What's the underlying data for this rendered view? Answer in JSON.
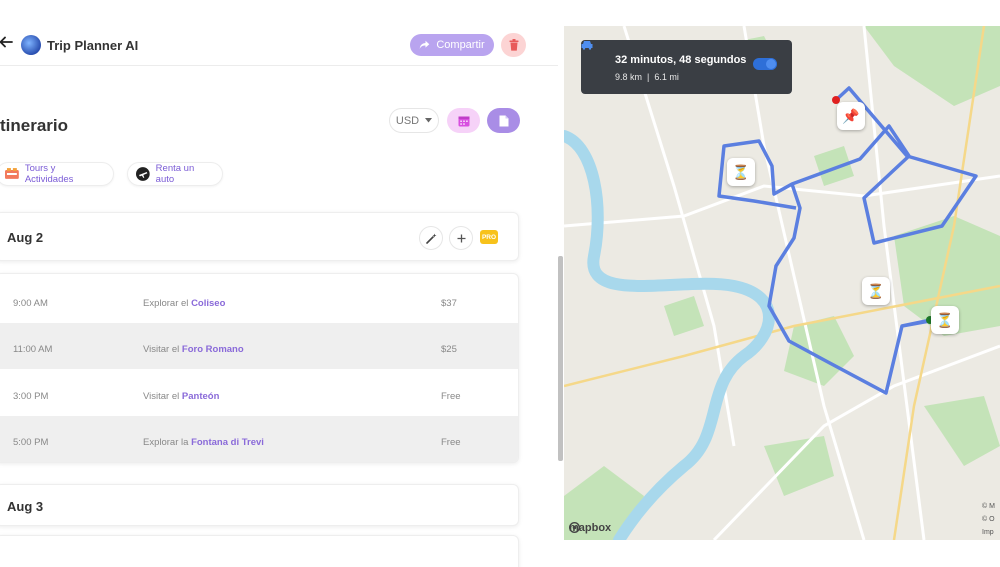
{
  "header": {
    "app_title": "Trip Planner AI",
    "share_label": "Compartir"
  },
  "itinerary": {
    "title": "tinerario",
    "currency": "USD"
  },
  "quick_links": {
    "tours_label": "Tours y Actividades",
    "car_label": "Renta un auto"
  },
  "days": [
    {
      "label": "Aug 2",
      "pro_badge": "PRO",
      "activities": [
        {
          "time": "9:00 AM",
          "verb": "Explorar el",
          "place": "Coliseo",
          "price": "$37"
        },
        {
          "time": "11:00 AM",
          "verb": "Visitar el",
          "place": "Foro Romano",
          "price": "$25"
        },
        {
          "time": "3:00 PM",
          "verb": "Visitar el",
          "place": "Panteón",
          "price": "Free"
        },
        {
          "time": "5:00 PM",
          "verb": "Explorar la",
          "place": "Fontana di Trevi",
          "price": "Free"
        }
      ]
    },
    {
      "label": "Aug 3"
    }
  ],
  "map": {
    "route_duration": "32 minutos, 48 segundos",
    "route_km": "9.8 km",
    "route_separator": "|",
    "route_mi": "6.1 mi",
    "route_toggle_on": true,
    "mapbox_label": "mapbox",
    "attribution_1": "© M",
    "attribution_2": "© O",
    "attribution_3": "Imp",
    "route_color": "#5b7fe0",
    "river_color": "#a8d8ec",
    "park_color": "#c4e3b8"
  },
  "colors": {
    "accent_purple": "#a98de6",
    "share_purple": "#b9a4ef",
    "delete_pink": "#fcd4d4",
    "calendar_pink": "#f6d2f8",
    "pro_yellow": "#f7c21b",
    "place_purple": "#8a6ad9"
  }
}
